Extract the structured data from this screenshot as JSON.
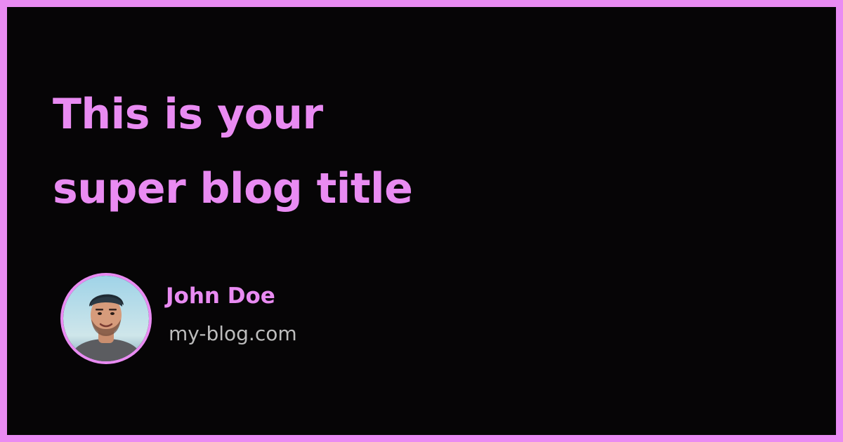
{
  "title_lines": [
    "This is your",
    "super blog title"
  ],
  "author": {
    "name": "John Doe",
    "site": "my-blog.com"
  },
  "colors": {
    "accent": "#e98bf2",
    "background": "#060506",
    "muted_text": "#bcbcbc"
  }
}
